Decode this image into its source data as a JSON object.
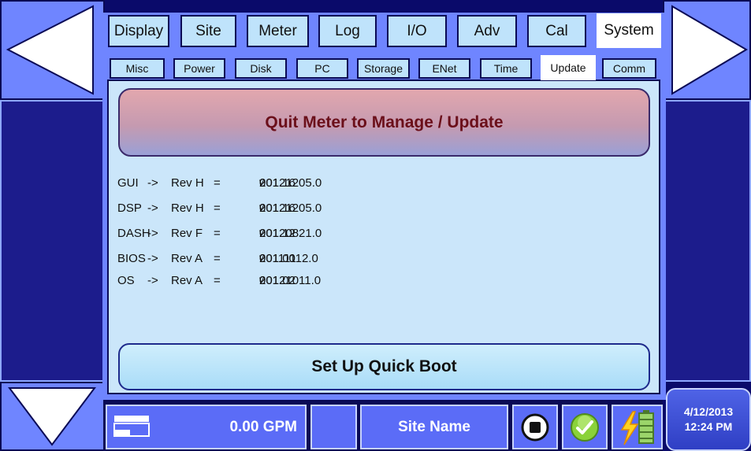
{
  "tabs": [
    {
      "label": "Display"
    },
    {
      "label": "Site"
    },
    {
      "label": "Meter"
    },
    {
      "label": "Log"
    },
    {
      "label": "I/O"
    },
    {
      "label": "Adv"
    },
    {
      "label": "Cal"
    },
    {
      "label": "System"
    }
  ],
  "active_tab": "System",
  "subtabs": [
    {
      "label": "Misc"
    },
    {
      "label": "Power"
    },
    {
      "label": "Disk"
    },
    {
      "label": "PC"
    },
    {
      "label": "Storage"
    },
    {
      "label": "ENet"
    },
    {
      "label": "Time"
    },
    {
      "label": "Update"
    },
    {
      "label": "Comm"
    }
  ],
  "active_subtab": "Update",
  "buttons": {
    "quit": "Quit Meter to Manage / Update",
    "quick_boot": "Set Up Quick Boot"
  },
  "versions": [
    {
      "name": "GUI",
      "arrow": "->",
      "rev": "Rev H",
      "eq": "=",
      "v": "v",
      "version": "001.16",
      "date": "20121205.0"
    },
    {
      "name": "DSP",
      "arrow": "->",
      "rev": "Rev H",
      "eq": "=",
      "v": "v",
      "version": "001.16",
      "date": "20121205.0"
    },
    {
      "name": "DASH",
      "arrow": "->",
      "rev": "Rev F",
      "eq": "=",
      "v": "v",
      "version": "001.12",
      "date": "20120821.0"
    },
    {
      "name": "BIOS",
      "arrow": "->",
      "rev": "Rev A",
      "eq": "=",
      "v": "v",
      "version": "001.00",
      "date": "20111112.0"
    },
    {
      "name": "OS",
      "arrow": "->",
      "rev": "Rev A",
      "eq": "=",
      "v": "v",
      "version": "001.02",
      "date": "20121011.0"
    }
  ],
  "status": {
    "flow": "0.00 GPM",
    "site_name": "Site Name",
    "date": "4/12/2013",
    "time": "12:24 PM",
    "icons": [
      "display-mode-icon",
      "stop-icon",
      "ok-check-icon",
      "power-battery-icon"
    ]
  },
  "colors": {
    "background": "#0a0a6a",
    "frame": "#6f85ff",
    "panel": "#cbe6fa",
    "tab": "#bfe3fb",
    "status": "#5b6cf7",
    "quit_text": "#6b0f1a"
  }
}
